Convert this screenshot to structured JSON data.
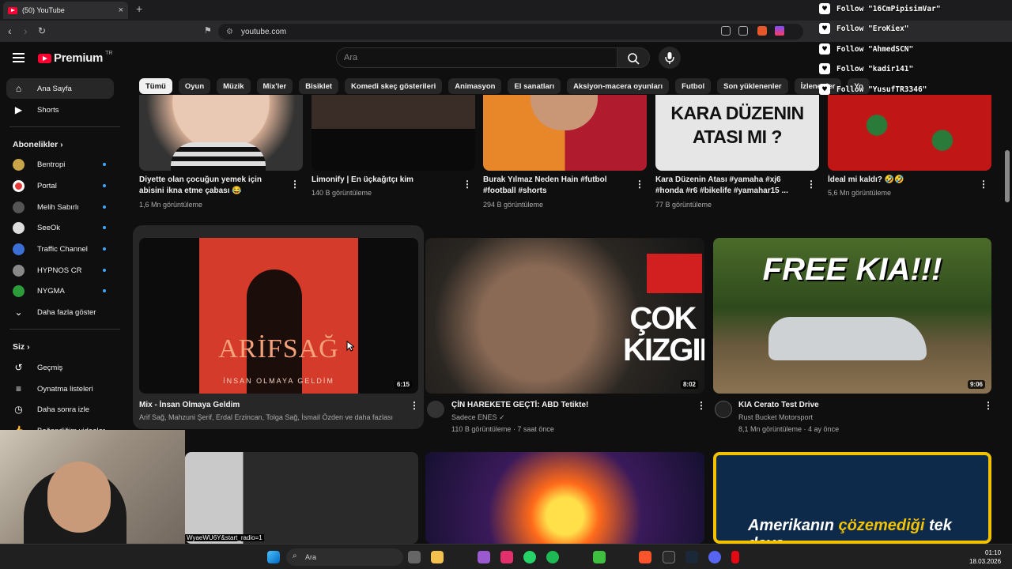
{
  "browser": {
    "tab_title": "(50) YouTube",
    "tab_close": "×",
    "new_tab": "+",
    "url": "youtube.com"
  },
  "header": {
    "logo_word": "Premium",
    "logo_region": "TR",
    "search_placeholder": "Ara"
  },
  "chips": [
    "Tümü",
    "Oyun",
    "Müzik",
    "Mix'ler",
    "Bisiklet",
    "Komedi skeç gösterileri",
    "Animasyon",
    "El sanatları",
    "Aksiyon-macera oyunları",
    "Futbol",
    "Son yüklenenler",
    "İzlenenler",
    "Yo"
  ],
  "sidebar": {
    "home": "Ana Sayfa",
    "shorts": "Shorts",
    "subs_header": "Abonelikler",
    "subs": [
      {
        "name": "Bentropi",
        "color": "#c9a54a"
      },
      {
        "name": "Portal",
        "color": "#e53935"
      },
      {
        "name": "Melih Sabırlı",
        "color": "#444"
      },
      {
        "name": "SeeOk",
        "color": "#ddd"
      },
      {
        "name": "Traffic Channel",
        "color": "#3b6fd6"
      },
      {
        "name": "HYPNOS CR",
        "color": "#888"
      },
      {
        "name": "NYGMA",
        "color": "#2e9b3a"
      }
    ],
    "show_more": "Daha fazla göster",
    "you_header": "Siz",
    "you_items": [
      "Geçmiş",
      "Oynatma listeleri",
      "Daha sonra izle",
      "Beğendiğim videolar"
    ]
  },
  "row1": [
    {
      "title": "Diyette olan çocuğun yemek için abisini ikna etme çabası 😂",
      "views": "1,6 Mn görüntüleme"
    },
    {
      "title": "Limonify | En üçkağıtçı kim",
      "views": "140 B görüntüleme"
    },
    {
      "title": "Burak Yılmaz Neden Hain #futbol #football #shorts",
      "views": "294 B görüntüleme"
    },
    {
      "title": "Kara Düzenin Atası #yamaha #xj6 #honda #r6 #bikelife #yamahar15 ...",
      "views": "77 B görüntüleme",
      "thumb_text": "KARA DÜZENIN ATASI MI ?"
    },
    {
      "title": "İdeal mi kaldı? 🤣🤣",
      "views": "5,6 Mn görüntüleme"
    }
  ],
  "row2": [
    {
      "title": "Mix - İnsan Olmaya Geldim",
      "channel": "Arif Sağ, Mahzuni Şerif, Erdal Erzincan, Tolga Sağ, İsmail Özden ve daha fazlası",
      "duration": "6:15",
      "thumb_text1": "ARİFSAĞ",
      "thumb_text2": "İNSAN OLMAYA GELDİM"
    },
    {
      "title": "ÇİN HAREKETE GEÇTİ: ABD Tetikte!",
      "channel": "Sadece ENES",
      "views": "110 B görüntüleme · 7 saat önce",
      "duration": "8:02",
      "thumb_text": "ÇOK KIZGIN"
    },
    {
      "title": "KIA Cerato Test Drive",
      "channel": "Rust Bucket Motorsport",
      "views": "8,1 Mn görüntüleme · 4 ay önce",
      "duration": "9:06",
      "thumb_text": "FREE KIA!!!"
    }
  ],
  "row3": {
    "thumb3_text_a": "Amerikanın",
    "thumb3_text_b": "çözemediği",
    "thumb3_text_c": "tek dava",
    "url_fragment": "WyaeWU6Y&start_radio=1"
  },
  "overlay_follows": [
    "Follow \"16CmPipisimVar\"",
    "Follow \"EroKiex\"",
    "Follow \"AhmedSCN\"",
    "Follow \"kadir141\"",
    "Follow \"YusufTR3346\""
  ],
  "taskbar": {
    "search": "Ara",
    "time": "01:10",
    "date": "18.03.2026"
  }
}
